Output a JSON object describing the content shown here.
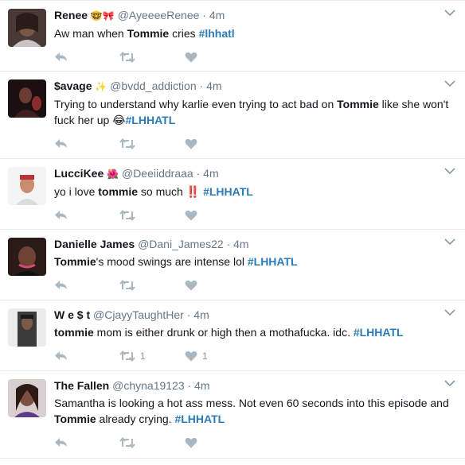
{
  "tweets": [
    {
      "name": "Renee",
      "name_emoji": "🤓🎀",
      "handle": "@AyeeeeRenee",
      "time": "4m",
      "segments": [
        {
          "t": "Aw man when ",
          "s": "plain"
        },
        {
          "t": "Tommie",
          "s": "bold"
        },
        {
          "t": " cries ",
          "s": "plain"
        },
        {
          "t": "#lhhatl",
          "s": "tag"
        }
      ],
      "retweets": "",
      "likes": ""
    },
    {
      "name": "$avage",
      "name_emoji": "✨",
      "handle": "@bvdd_addiction",
      "time": "4m",
      "segments": [
        {
          "t": "Trying to understand why karlie even trying to act bad on ",
          "s": "plain"
        },
        {
          "t": "Tommie",
          "s": "bold"
        },
        {
          "t": " like she won't fuck her up ",
          "s": "plain"
        },
        {
          "t": "😂",
          "s": "plain"
        },
        {
          "t": "#LHHATL",
          "s": "tag"
        }
      ],
      "retweets": "",
      "likes": ""
    },
    {
      "name": "LucciKee",
      "name_emoji": "🌺",
      "handle": "@Deeiiddraaa",
      "time": "4m",
      "segments": [
        {
          "t": "yo i love ",
          "s": "plain"
        },
        {
          "t": "tommie",
          "s": "bold"
        },
        {
          "t": " so much ",
          "s": "plain"
        },
        {
          "t": "‼️",
          "s": "bang"
        },
        {
          "t": " ",
          "s": "plain"
        },
        {
          "t": "#LHHATL",
          "s": "tag"
        }
      ],
      "retweets": "",
      "likes": ""
    },
    {
      "name": "Danielle James",
      "name_emoji": "",
      "handle": "@Dani_James22",
      "time": "4m",
      "segments": [
        {
          "t": "Tommie",
          "s": "bold"
        },
        {
          "t": "'s mood swings are intense lol ",
          "s": "plain"
        },
        {
          "t": "#LHHATL",
          "s": "tag"
        }
      ],
      "retweets": "",
      "likes": ""
    },
    {
      "name": "W e $ t",
      "name_emoji": "",
      "handle": "@CjayyTaughtHer",
      "time": "4m",
      "segments": [
        {
          "t": "tommie",
          "s": "bold"
        },
        {
          "t": " mom is either drunk or high then a mothafucka. idc. ",
          "s": "plain"
        },
        {
          "t": "#LHHATL",
          "s": "tag"
        }
      ],
      "retweets": "1",
      "likes": "1"
    },
    {
      "name": "The Fallen",
      "name_emoji": "",
      "handle": "@chyna19123",
      "time": "4m",
      "segments": [
        {
          "t": "Samantha is looking a hot ass mess. Not even 60 seconds into this episode and ",
          "s": "plain"
        },
        {
          "t": "Tommie",
          "s": "bold"
        },
        {
          "t": " already crying. ",
          "s": "plain"
        },
        {
          "t": "#LHHATL",
          "s": "tag"
        }
      ],
      "retweets": "",
      "likes": ""
    }
  ],
  "colors": {
    "hashtag": "#2b7bb9",
    "meta": "#657786",
    "action_icon": "#aab8c2",
    "divider": "#e6ecf0"
  },
  "icons": {
    "reply": "reply-icon",
    "retweet": "retweet-icon",
    "like": "heart-icon",
    "more": "chevron-down-icon"
  }
}
